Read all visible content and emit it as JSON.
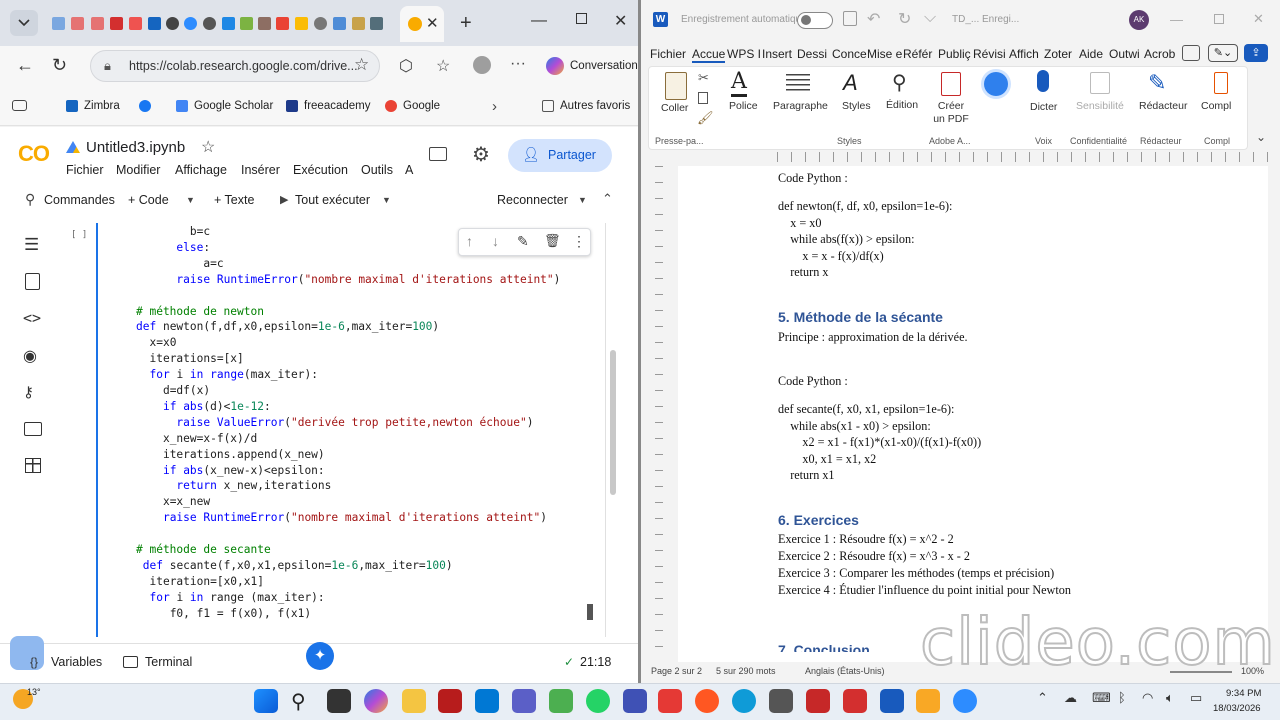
{
  "browser": {
    "tab_title": "Untitled3.ipynb",
    "url": "https://colab.research.google.com/drive...",
    "conversation_label": "Conversation",
    "bookmarks": [
      "Zimbra",
      "Google Scholar",
      "freeacademy",
      "Google"
    ],
    "other_favorites": "Autres favoris"
  },
  "colab": {
    "logo": "CO",
    "notebook_title": "Untitled3.ipynb",
    "menus": [
      "Fichier",
      "Modifier",
      "Affichage",
      "Insérer",
      "Exécution",
      "Outils",
      "A"
    ],
    "share_label": "Partager",
    "toolbar": {
      "commands": "Commandes",
      "code": "+ Code",
      "text": "+ Texte",
      "run_all": "Tout exécuter",
      "reconnect": "Reconnecter"
    },
    "cell_exec": "[ ]",
    "code_lines": [
      {
        "indent": "        ",
        "parts": [
          [
            "",
            "b=c"
          ]
        ]
      },
      {
        "indent": "      ",
        "parts": [
          [
            "kw",
            "else"
          ],
          [
            "",
            ":"
          ]
        ]
      },
      {
        "indent": "          ",
        "parts": [
          [
            "",
            "a=c"
          ]
        ]
      },
      {
        "indent": "      ",
        "parts": [
          [
            "kw",
            "raise"
          ],
          [
            "",
            " "
          ],
          [
            "kw",
            "RuntimeError"
          ],
          [
            "",
            "("
          ],
          [
            "st",
            "\"nombre maximal d'iterations atteint\""
          ],
          [
            "",
            ")"
          ]
        ]
      },
      {
        "indent": "",
        "parts": [
          [
            "",
            ""
          ]
        ]
      },
      {
        "indent": "",
        "parts": [
          [
            "cm",
            "# méthode de newton"
          ]
        ]
      },
      {
        "indent": "",
        "parts": [
          [
            "kw",
            "def"
          ],
          [
            "",
            " newton(f,df,x0,epsilon="
          ],
          [
            "nm",
            "1e-6"
          ],
          [
            "",
            ",max_iter="
          ],
          [
            "nm",
            "100"
          ],
          [
            "",
            ")"
          ]
        ]
      },
      {
        "indent": "  ",
        "parts": [
          [
            "",
            "x=x0"
          ]
        ]
      },
      {
        "indent": "  ",
        "parts": [
          [
            "",
            "iterations=[x]"
          ]
        ]
      },
      {
        "indent": "  ",
        "parts": [
          [
            "kw",
            "for"
          ],
          [
            "",
            " i "
          ],
          [
            "kw",
            "in"
          ],
          [
            "",
            " "
          ],
          [
            "kw",
            "range"
          ],
          [
            "",
            "(max_iter):"
          ]
        ]
      },
      {
        "indent": "    ",
        "parts": [
          [
            "",
            "d=df(x)"
          ]
        ]
      },
      {
        "indent": "    ",
        "parts": [
          [
            "kw",
            "if"
          ],
          [
            "",
            " "
          ],
          [
            "kw",
            "abs"
          ],
          [
            "",
            "(d)<"
          ],
          [
            "nm",
            "1e-12"
          ],
          [
            "",
            ":"
          ]
        ]
      },
      {
        "indent": "      ",
        "parts": [
          [
            "kw",
            "raise"
          ],
          [
            "",
            " "
          ],
          [
            "kw",
            "ValueError"
          ],
          [
            "",
            "("
          ],
          [
            "st",
            "\"derivée trop petite,newton échoue\""
          ],
          [
            "",
            ")"
          ]
        ]
      },
      {
        "indent": "    ",
        "parts": [
          [
            "",
            "x_new=x-f(x)/d"
          ]
        ]
      },
      {
        "indent": "    ",
        "parts": [
          [
            "",
            "iterations.append(x_new)"
          ]
        ]
      },
      {
        "indent": "    ",
        "parts": [
          [
            "kw",
            "if"
          ],
          [
            "",
            " "
          ],
          [
            "kw",
            "abs"
          ],
          [
            "",
            "(x_new-x)<epsilon:"
          ]
        ]
      },
      {
        "indent": "      ",
        "parts": [
          [
            "kw",
            "return"
          ],
          [
            "",
            " x_new,iterations"
          ]
        ]
      },
      {
        "indent": "    ",
        "parts": [
          [
            "",
            "x=x_new"
          ]
        ]
      },
      {
        "indent": "    ",
        "parts": [
          [
            "kw",
            "raise"
          ],
          [
            "",
            " "
          ],
          [
            "kw",
            "RuntimeError"
          ],
          [
            "",
            "("
          ],
          [
            "st",
            "\"nombre maximal d'iterations atteint\""
          ],
          [
            "",
            ")"
          ]
        ]
      },
      {
        "indent": "",
        "parts": [
          [
            "",
            ""
          ]
        ]
      },
      {
        "indent": "",
        "parts": [
          [
            "cm",
            "# méthode de secante"
          ]
        ]
      },
      {
        "indent": " ",
        "parts": [
          [
            "kw",
            "def"
          ],
          [
            "",
            " secante(f,x0,x1,epsilon="
          ],
          [
            "nm",
            "1e-6"
          ],
          [
            "",
            ",max_iter="
          ],
          [
            "nm",
            "100"
          ],
          [
            "",
            ")"
          ]
        ]
      },
      {
        "indent": "  ",
        "parts": [
          [
            "",
            "iteration=[x0,x1]"
          ]
        ]
      },
      {
        "indent": "  ",
        "parts": [
          [
            "kw",
            "for"
          ],
          [
            "",
            " i "
          ],
          [
            "kw",
            "in"
          ],
          [
            "",
            " range (max_iter):"
          ]
        ]
      },
      {
        "indent": "     ",
        "parts": [
          [
            "",
            "f0, f1 = f(x0), f(x1)"
          ]
        ]
      }
    ],
    "status": {
      "variables": "Variables",
      "terminal": "Terminal",
      "time": "21:18"
    }
  },
  "word": {
    "autosave": "Enregistrement automatique",
    "doc_title": "TD_...",
    "saving": "Enregi...",
    "avatar": "AK",
    "menus": [
      "Fichier",
      "Accue",
      "WPS I",
      "Insert",
      "Dessi",
      "Conce",
      "Mise e",
      "Référ",
      "Publiç",
      "Révisi",
      "Affich",
      "Zoter",
      "Aide",
      "Outwi",
      "Acrob"
    ],
    "ribbon": {
      "paste": "Coller",
      "font": "Police",
      "paragraph": "Paragraphe",
      "styles": "Styles",
      "editing": "Édition",
      "create_pdf": "Créer un PDF",
      "dictate": "Dicter",
      "sensitivity": "Sensibilité",
      "editor": "Rédacteur",
      "compl": "Compl",
      "group_clipboard": "Presse-pa...",
      "group_styles": "Styles",
      "group_adobe": "Adobe A...",
      "group_voice": "Voix",
      "group_confidential": "Confidentialité",
      "group_editor": "Rédacteur",
      "group_compl": "Compl"
    },
    "doc": {
      "code_label_1": "Code Python :",
      "newton_code": [
        "def newton(f, df, x0, epsilon=1e-6):",
        "    x = x0",
        "    while abs(f(x)) > epsilon:",
        "        x = x - f(x)/df(x)",
        "    return x"
      ],
      "h5": "5. Méthode de la sécante",
      "principle": "Principe : approximation de la dérivée.",
      "code_label_2": "Code Python :",
      "secant_code": [
        "def secante(f, x0, x1, epsilon=1e-6):",
        "    while abs(x1 - x0) > epsilon:",
        "        x2 = x1 - f(x1)*(x1-x0)/(f(x1)-f(x0))",
        "        x0, x1 = x1, x2",
        "    return x1"
      ],
      "h6": "6. Exercices",
      "exercises": [
        "Exercice 1 : Résoudre f(x) = x^2 - 2",
        "Exercice 2 : Résoudre f(x) = x^3 - x - 2",
        "Exercice 3 : Comparer les méthodes (temps et précision)",
        "Exercice 4 : Étudier l'influence du point initial pour Newton"
      ],
      "h7_partial": "7. Conclusion"
    },
    "status": {
      "page": "Page 2 sur 2",
      "words": "5 sur 290 mots",
      "lang": "Anglais (États-Unis)",
      "zoom": "100%"
    }
  },
  "taskbar": {
    "weather": "13°",
    "time": "9:34 PM",
    "date": "18/03/2026"
  },
  "watermark": "clideo.com",
  "colors": {
    "colab_orange": "#f9ab00",
    "colab_blue": "#1a73e8",
    "word_blue": "#2f5496"
  }
}
